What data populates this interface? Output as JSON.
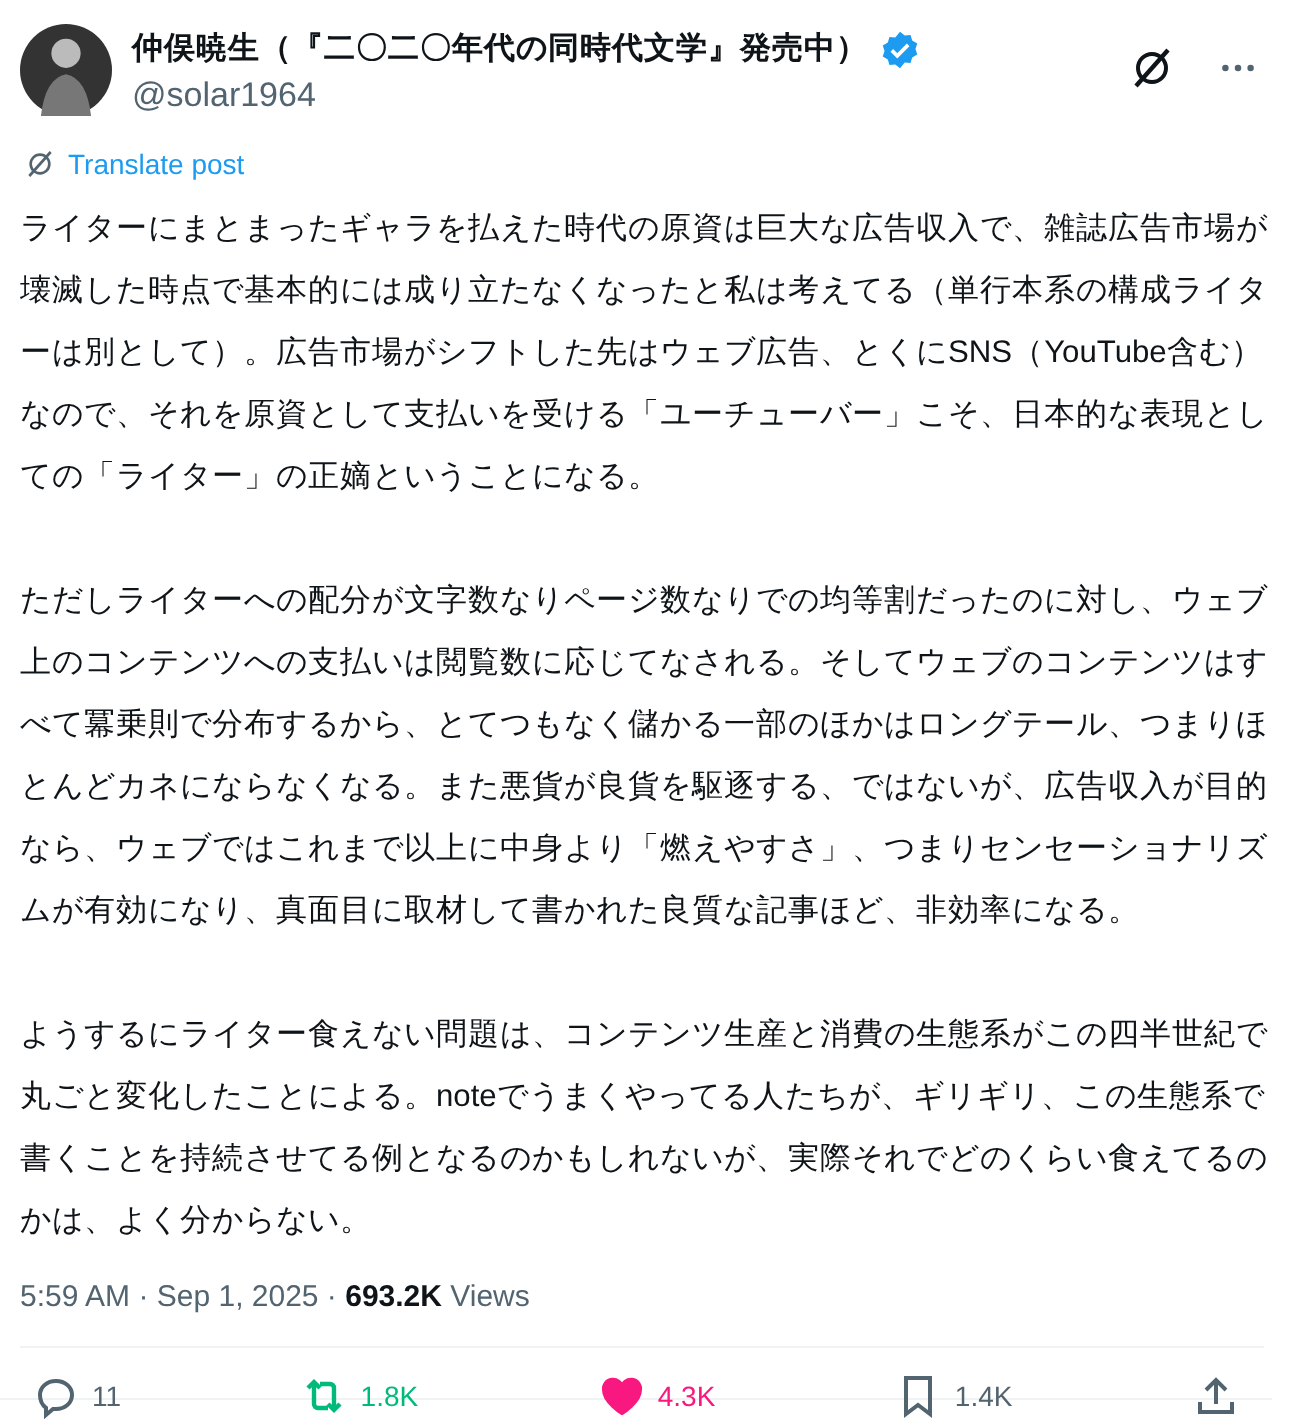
{
  "post": {
    "author": {
      "name": "仲俣暁生（『二〇二〇年代の同時代文学』発売中）",
      "verified": true,
      "handle": "@solar1964"
    },
    "translate": "Translate post",
    "paragraphs": [
      "ライターにまとまったギャラを払えた時代の原資は巨大な広告収入で、雑誌広告市場が壊滅した時点で基本的には成り立たなくなったと私は考えてる（単行本系の構成ライターは別として）。広告市場がシフトした先はウェブ広告、とくにSNS（YouTube含む）なので、それを原資として支払いを受ける「ユーチューバー」こそ、日本的な表現としての「ライター」の正嫡ということになる。",
      "ただしライターへの配分が文字数なりページ数なりでの均等割だったのに対し、ウェブ上のコンテンツへの支払いは閲覧数に応じてなされる。そしてウェブのコンテンツはすべて冪乗則で分布するから、とてつもなく儲かる一部のほかはロングテール、つまりほとんどカネにならなくなる。また悪貨が良貨を駆逐する、ではないが、広告収入が目的なら、ウェブではこれまで以上に中身より「燃えやすさ」、つまりセンセーショナリズムが有効になり、真面目に取材して書かれた良質な記事ほど、非効率になる。",
      "ようするにライター食えない問題は、コンテンツ生産と消費の生態系がこの四半世紀で丸ごと変化したことによる。noteでうまくやってる人たちが、ギリギリ、この生態系で書くことを持続させてる例となるのかもしれないが、実際それでどのくらい食えてるのかは、よく分からない。"
    ],
    "time": "5:59 AM · Sep 1, 2025 · ",
    "views_count": "693.2K",
    "views_label": " Views",
    "actions": [
      {
        "kind": "reply",
        "count": "11",
        "on": false
      },
      {
        "kind": "repost",
        "count": "1.8K",
        "on": true
      },
      {
        "kind": "like",
        "count": "4.3K",
        "on": true
      },
      {
        "kind": "bookmark",
        "count": "1.4K",
        "on": false
      },
      {
        "kind": "share",
        "on": false
      }
    ]
  }
}
